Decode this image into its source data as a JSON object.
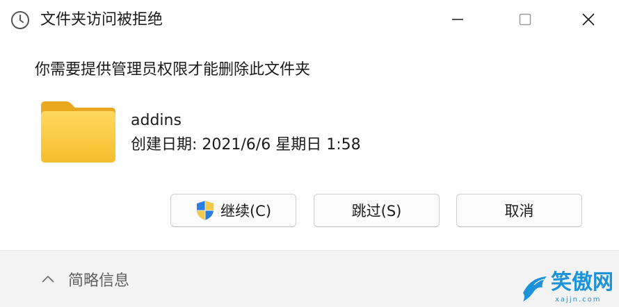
{
  "window": {
    "title": "文件夹访问被拒绝",
    "controls": [
      "minimize-icon",
      "maximize-icon",
      "close-icon"
    ],
    "title_icon": "clock-icon"
  },
  "message": "你需要提供管理员权限才能删除此文件夹",
  "file": {
    "icon": "folder-icon",
    "name": "addins",
    "created": "创建日期: 2021/6/6 星期日 1:58"
  },
  "buttons": {
    "continue_label": "继续(C)",
    "skip_label": "跳过(S)",
    "cancel_label": "取消"
  },
  "footer": {
    "details_label": "简略信息"
  },
  "watermark": {
    "text": "笑傲网",
    "url": "xajjn.com"
  },
  "colors": {
    "folder": "#f8c940",
    "footer_bg": "#f3f3f3",
    "watermark": "#1c93d8"
  }
}
